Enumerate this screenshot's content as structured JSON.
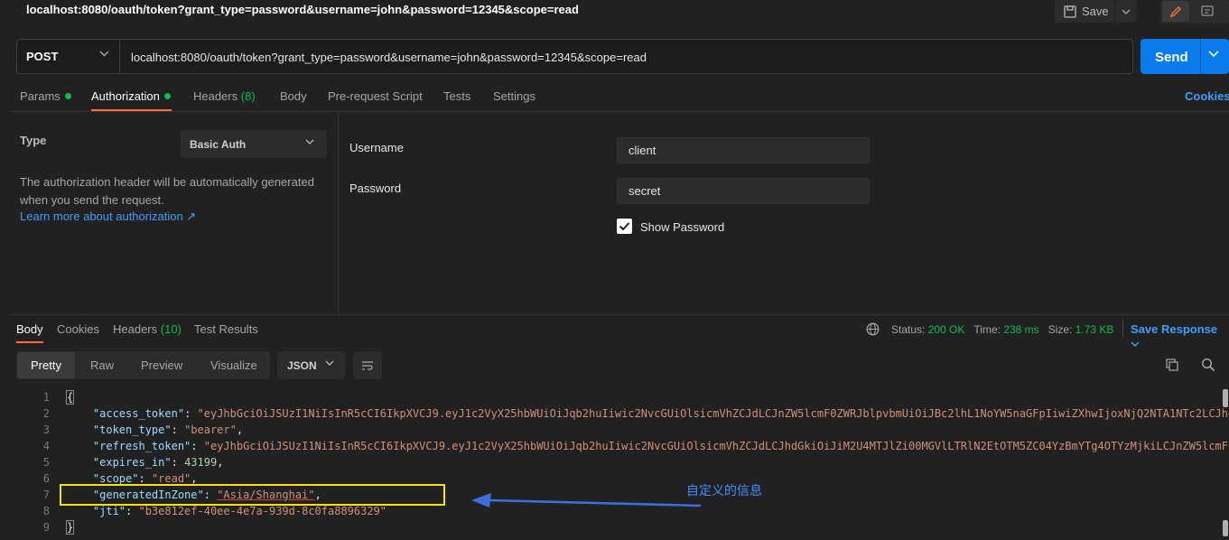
{
  "window": {
    "title": "localhost:8080/oauth/token?grant_type=password&username=john&password=12345&scope=read"
  },
  "toolbar": {
    "save_label": "Save"
  },
  "request": {
    "method": "POST",
    "url": "localhost:8080/oauth/token?grant_type=password&username=john&password=12345&scope=read",
    "send_label": "Send"
  },
  "request_tabs": {
    "params": "Params",
    "authorization": "Authorization",
    "headers": "Headers",
    "headers_count": "(8)",
    "body": "Body",
    "prerequest": "Pre-request Script",
    "tests": "Tests",
    "settings": "Settings",
    "cookies": "Cookies"
  },
  "auth": {
    "type_label": "Type",
    "type_value": "Basic Auth",
    "description": "The authorization header will be automatically generated when you send the request.",
    "learn_more": "Learn more about authorization ↗",
    "username_label": "Username",
    "username_value": "client",
    "password_label": "Password",
    "password_value": "secret",
    "show_password_label": "Show Password",
    "show_password_checked": true
  },
  "response_tabs": {
    "body": "Body",
    "cookies": "Cookies",
    "headers": "Headers",
    "headers_count": "(10)",
    "test_results": "Test Results",
    "save_response": "Save Response"
  },
  "response_status": {
    "status_label": "Status:",
    "status_value": "200 OK",
    "time_label": "Time:",
    "time_value": "238 ms",
    "size_label": "Size:",
    "size_value": "1.73 KB"
  },
  "view_modes": {
    "pretty": "Pretty",
    "raw": "Raw",
    "preview": "Preview",
    "visualize": "Visualize",
    "format": "JSON"
  },
  "code_lines": [
    {
      "n": "1"
    },
    {
      "n": "2",
      "key": "\"access_token\"",
      "val": "\"eyJhbGciOiJSUzI1NiIsInR5cCI6IkpXVCJ9.eyJ1c2VyX25hbWUiOiJqb2huIiwic2NvcGUiOlsicmVhZCJdLCJnZW5lcmF0ZWRJblpvbmUiOiJBc2lhL1NoYW5naGFpIiwiZXhwIjoxNjQ2NTA1NTc2LCJhdXRob"
    },
    {
      "n": "3",
      "key": "\"token_type\"",
      "val": "\"bearer\""
    },
    {
      "n": "4",
      "key": "\"refresh_token\"",
      "val": "\"eyJhbGciOiJSUzI1NiIsInR5cCI6IkpXVCJ9.eyJ1c2VyX25hbWUiOiJqb2huIiwic2NvcGUiOlsicmVhZCJdLCJhdGkiOiJiM2U4MTJlZi00MGVlLTRlN2EtOTM5ZC04YzBmYTg4OTYzMjkiLCJnZW5lcmF0Z"
    },
    {
      "n": "5",
      "key": "\"expires_in\"",
      "num": "43199"
    },
    {
      "n": "6",
      "key": "\"scope\"",
      "val": "\"read\""
    },
    {
      "n": "7",
      "key": "\"generatedInZone\"",
      "val": "\"Asia/Shanghai\""
    },
    {
      "n": "8",
      "key": "\"jti\"",
      "val": "\"b3e812ef-40ee-4e7a-939d-8c0fa8896329\""
    },
    {
      "n": "9"
    }
  ],
  "annotation": {
    "note": "自定义的信息",
    "color": "#f5e10b",
    "arrow_color": "#3b6fe0"
  },
  "colors": {
    "accent": "#ff6c37",
    "send": "#097bed",
    "link": "#3f9ef8",
    "success": "#0cbb52"
  }
}
